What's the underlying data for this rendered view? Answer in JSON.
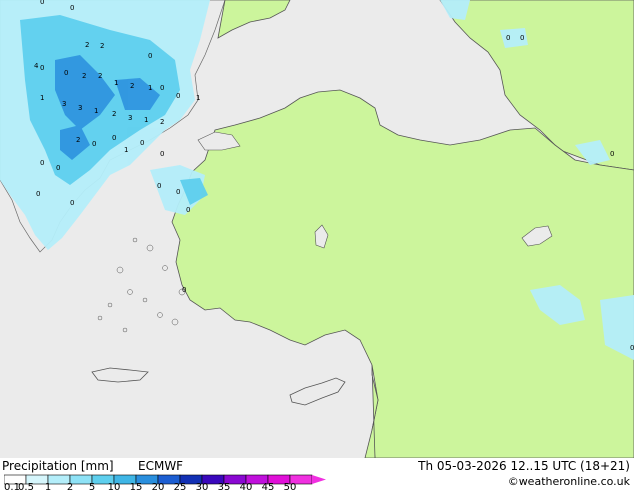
{
  "footer": {
    "title": "Precipitation [mm]",
    "model": "ECMWF",
    "valid_time": "Th 05-03-2026 12..15 UTC (18+21)",
    "credit": "©weatheronline.co.uk"
  },
  "legend": {
    "ticks": [
      "0.1",
      "0.5",
      "1",
      "2",
      "5",
      "10",
      "15",
      "20",
      "25",
      "30",
      "35",
      "40",
      "45",
      "50"
    ],
    "colors": [
      "#fefefe",
      "#d6f6fc",
      "#b4eefa",
      "#8ee2f6",
      "#5ecfee",
      "#3fb6e6",
      "#2a8fde",
      "#1c5ed2",
      "#1230b4",
      "#3a08bc",
      "#8a08d2",
      "#c010dc",
      "#e010d8",
      "#f030e0"
    ]
  },
  "map": {
    "colors": {
      "sea": "#ebebeb",
      "land_dry": "#ccf59c",
      "land_nodata": "#ebebeb",
      "border": "#808080",
      "coast": "#555555",
      "precip_light": "#b4eefa",
      "precip_mid": "#5ecfee",
      "precip_heavy": "#2a8fde"
    },
    "value_labels": [
      "0",
      "0",
      "2",
      "0",
      "2",
      "0",
      "4",
      "0",
      "2",
      "2",
      "1",
      "2",
      "1",
      "3",
      "3",
      "1",
      "2",
      "3",
      "1",
      "2",
      "1",
      "0",
      "0",
      "2",
      "0",
      "1",
      "0",
      "0",
      "0",
      "0",
      "0",
      "0",
      "0",
      "1",
      "0",
      "0",
      "0",
      "0",
      "0",
      "0",
      "0",
      "0"
    ]
  }
}
